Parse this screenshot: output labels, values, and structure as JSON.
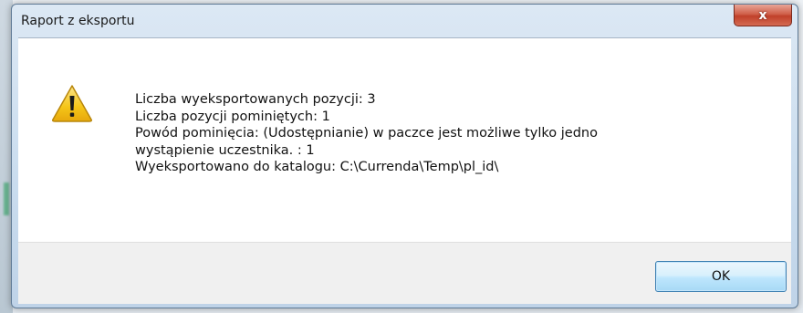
{
  "window": {
    "title": "Raport z eksportu",
    "close_label": "x"
  },
  "message": {
    "lines": [
      "Liczba wyeksportowanych pozycji:  3",
      "Liczba pozycji pominiętych: 1",
      "Powód pominięcia: (Udostępnianie) w paczce jest możliwe tylko jedno",
      "wystąpienie uczestnika. : 1",
      "Wyeksportowano do katalogu: C:\\Currenda\\Temp\\pl_id\\"
    ]
  },
  "buttons": {
    "ok_label": "OK"
  },
  "icons": {
    "message_icon": "warning-icon",
    "close_icon": "close-icon"
  },
  "colors": {
    "close_button": "#c0402a",
    "warning_fill": "#f5c518",
    "ok_border": "#3c7fb1"
  }
}
